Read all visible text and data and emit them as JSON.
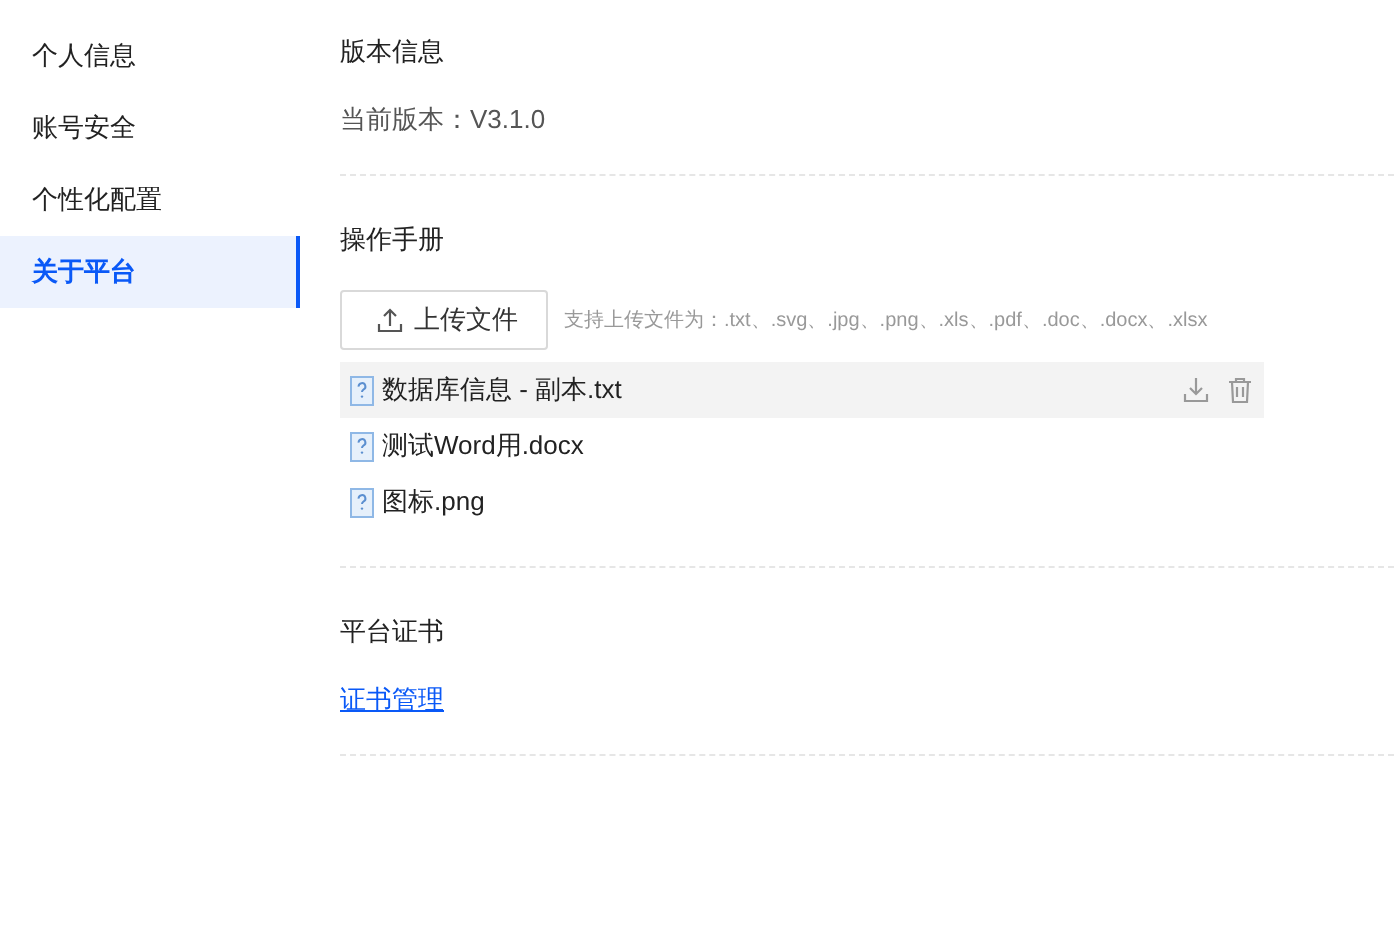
{
  "sidebar": {
    "items": [
      {
        "label": "个人信息",
        "selected": false
      },
      {
        "label": "账号安全",
        "selected": false
      },
      {
        "label": "个性化配置",
        "selected": false
      },
      {
        "label": "关于平台",
        "selected": true
      }
    ]
  },
  "version_section": {
    "title": "版本信息",
    "label": "当前版本：",
    "value": "V3.1.0"
  },
  "manual_section": {
    "title": "操作手册",
    "upload_button": "上传文件",
    "hint": "支持上传文件为：.txt、.svg、.jpg、.png、.xls、.pdf、.doc、.docx、.xlsx",
    "files": [
      {
        "name": "数据库信息 - 副本.txt",
        "highlighted": true
      },
      {
        "name": "测试Word用.docx",
        "highlighted": false
      },
      {
        "name": "图标.png",
        "highlighted": false
      }
    ]
  },
  "certificate_section": {
    "title": "平台证书",
    "link": "证书管理"
  }
}
